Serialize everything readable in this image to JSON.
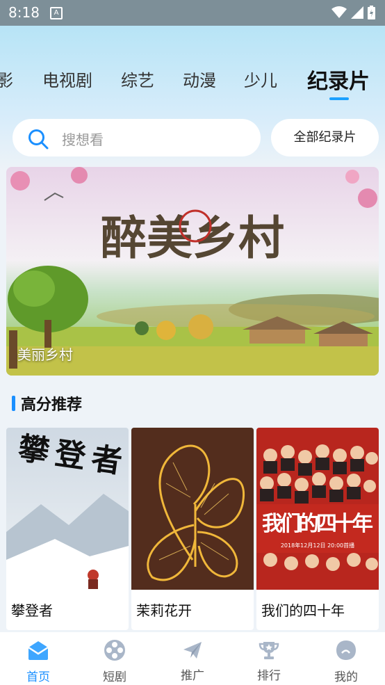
{
  "status_bar": {
    "time": "8:18",
    "notification_letter": "A"
  },
  "tabs": [
    {
      "label": "影"
    },
    {
      "label": "电视剧"
    },
    {
      "label": "综艺"
    },
    {
      "label": "动漫"
    },
    {
      "label": "少儿"
    },
    {
      "label": "纪录片",
      "active": true
    }
  ],
  "search": {
    "placeholder": "搜想看"
  },
  "all_button": {
    "label": "全部纪录片"
  },
  "banner": {
    "caption": "美丽乡村",
    "artwork_text": "醉美乡村"
  },
  "section": {
    "title": "高分推荐"
  },
  "cards": [
    {
      "title": "攀登者",
      "poster_text": "攀登者"
    },
    {
      "title": "茉莉花开"
    },
    {
      "title": "我们的四十年",
      "poster_text": "我们的四十年",
      "poster_subtext": "2018年12月12日 20:00首播"
    }
  ],
  "bottom_nav": [
    {
      "label": "首页",
      "icon": "home-icon",
      "active": true
    },
    {
      "label": "短剧",
      "icon": "film-reel-icon"
    },
    {
      "label": "推广",
      "icon": "paper-plane-icon"
    },
    {
      "label": "排行",
      "icon": "trophy-icon"
    },
    {
      "label": "我的",
      "icon": "profile-icon"
    }
  ],
  "colors": {
    "accent": "#1a8fff",
    "header_gradient_top": "#b7e4f6"
  }
}
